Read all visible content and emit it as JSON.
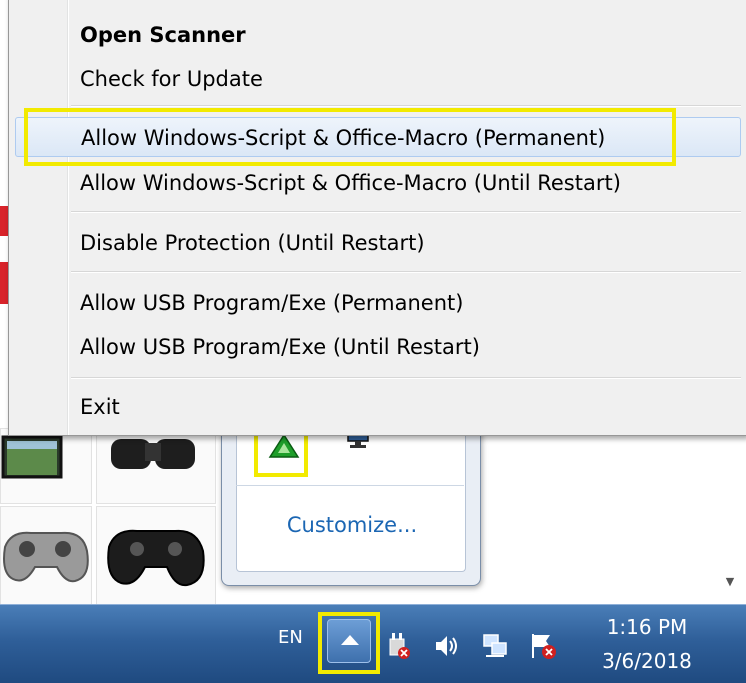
{
  "context_menu": {
    "items": [
      {
        "label": "Open Scanner",
        "bold": true
      },
      {
        "label": "Check for Update"
      },
      {
        "label": "Allow Windows-Script & Office-Macro (Permanent)",
        "highlighted": true
      },
      {
        "label": "Allow Windows-Script & Office-Macro (Until Restart)"
      },
      {
        "label": "Disable Protection (Until Restart)"
      },
      {
        "label": "Allow USB Program/Exe (Permanent)"
      },
      {
        "label": "Allow USB Program/Exe (Until Restart)"
      },
      {
        "label": "Exit"
      }
    ]
  },
  "tray_popup": {
    "customize_label": "Customize...",
    "icons": [
      "green-shield-icon",
      "network-monitor-icon"
    ]
  },
  "taskbar": {
    "language": "EN",
    "time": "1:16 PM",
    "date": "3/6/2018",
    "icons": [
      "overflow-arrow-icon",
      "power-plug-icon",
      "volume-icon",
      "network-icon",
      "action-center-flag-icon"
    ]
  },
  "colors": {
    "highlight_box": "#f2ea00",
    "taskbar": "#2f5f99",
    "link": "#1b66b3"
  }
}
